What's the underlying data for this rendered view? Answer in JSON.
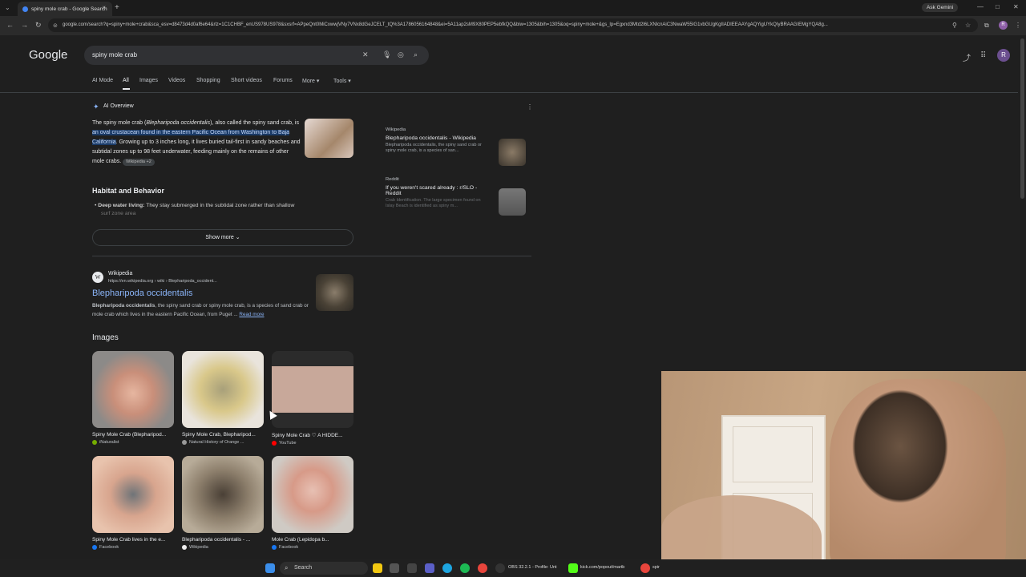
{
  "browser": {
    "tab_title": "spiny mole crab - Google Search",
    "tab_close": "×",
    "new_tab": "+",
    "ask_gemini": "Ask Gemini",
    "address": "google.com/search?q=spiny+mole+crab&sca_esv=d8473d4d0af6e64&rlz=1C1CHBF_enUS978US978&sxsrf=APpeQnt0MiCxwwjVNy7VNx8dGeJCELT_tQ%3A1786056164848&ei=5A11ap2sM9X80PEP5ebfkQQ&biw=1305&bih=1305&oq=spiny+mole+&gs_lp=Egxnd3Mtd2l6LXNlcnAiC3NwaW55IG1vbGUgKgIIADIEEAAYgAQYigUYkQIyBRAAGIEMgYQA8g...",
    "profile_initial": "R"
  },
  "google": {
    "logo": "Google",
    "query": "spiny mole crab",
    "account_initial": "R",
    "nav": [
      "AI Mode",
      "All",
      "Images",
      "Videos",
      "Shopping",
      "Short videos",
      "Forums",
      "More ▾",
      "Tools ▾"
    ]
  },
  "ai_overview": {
    "label": "AI Overview",
    "text_a": "The spiny mole crab (",
    "text_italic": "Blepharipoda occidentalis",
    "text_b": "), also called the spiny sand crab, is ",
    "highlight": "an oval crustacean found in the eastern Pacific Ocean from Washington to Baja California",
    "text_c": ". Growing up to 3 inches long, it lives buried tail-first in sandy beaches and subtidal zones up to 98 feet underwater, feeding mainly on the remains of other mole crabs.",
    "chip": "Wikipedia +2",
    "habitat_heading": "Habitat and Behavior",
    "bullet_bold": "Deep water living:",
    "bullet_text": " They stay submerged in the subtidal zone rather than shallow",
    "bullet_fade": "surf zone area",
    "show_more": "Show more ⌄",
    "sources": [
      {
        "site": "Wikipedia",
        "title": "Blepharipoda occidentalis - Wikipedia",
        "snippet": "Blepharipoda occidentalis, the spiny sand crab or spiny mole crab, is a species of san..."
      },
      {
        "site": "Reddit",
        "title": "If you weren't scared already : r/SLO - Reddit",
        "snippet": "Crab Identification. The large specimen found on Islay Beach is identified as spiny m..."
      }
    ]
  },
  "result": {
    "site": "Wikipedia",
    "url": "https://en.wikipedia.org › wiki › Blepharipoda_occident...",
    "favicon": "W",
    "title": "Blepharipoda occidentalis",
    "snippet_bold": "Blepharipoda occidentalis",
    "snippet": ", the spiny sand crab or spiny mole crab, is a species of sand crab or mole crab which lives in the eastern Pacific Ocean, from Puget ... ",
    "read_more": "Read more"
  },
  "images": {
    "heading": "Images",
    "tiles": [
      {
        "caption": "Spiny Mole Crab (Blepharipod...",
        "source": "iNaturalist"
      },
      {
        "caption": "Spiny Mole Crab, Blepharipod...",
        "source": "Natural History of Orange ..."
      },
      {
        "caption": "Spiny Mole Crab ♡ A HIDDE...",
        "source": "YouTube"
      },
      {
        "caption": "Spiny Mole Crab lives in the e...",
        "source": "Facebook"
      },
      {
        "caption": "Blepharipoda occidentalis - ...",
        "source": "Wikipedia"
      },
      {
        "caption": "Mole Crab (Lepidopa b...",
        "source": "Facebook"
      }
    ]
  },
  "taskbar": {
    "search": "Search",
    "obs": "OBS 32.2.1 - Profile: Unt",
    "kick": "kick.com/popout/martb",
    "last": "spir"
  },
  "colors": {
    "link": "#8ab4f8",
    "highlight": "#1a3a66",
    "bg": "#1f1f1f"
  }
}
